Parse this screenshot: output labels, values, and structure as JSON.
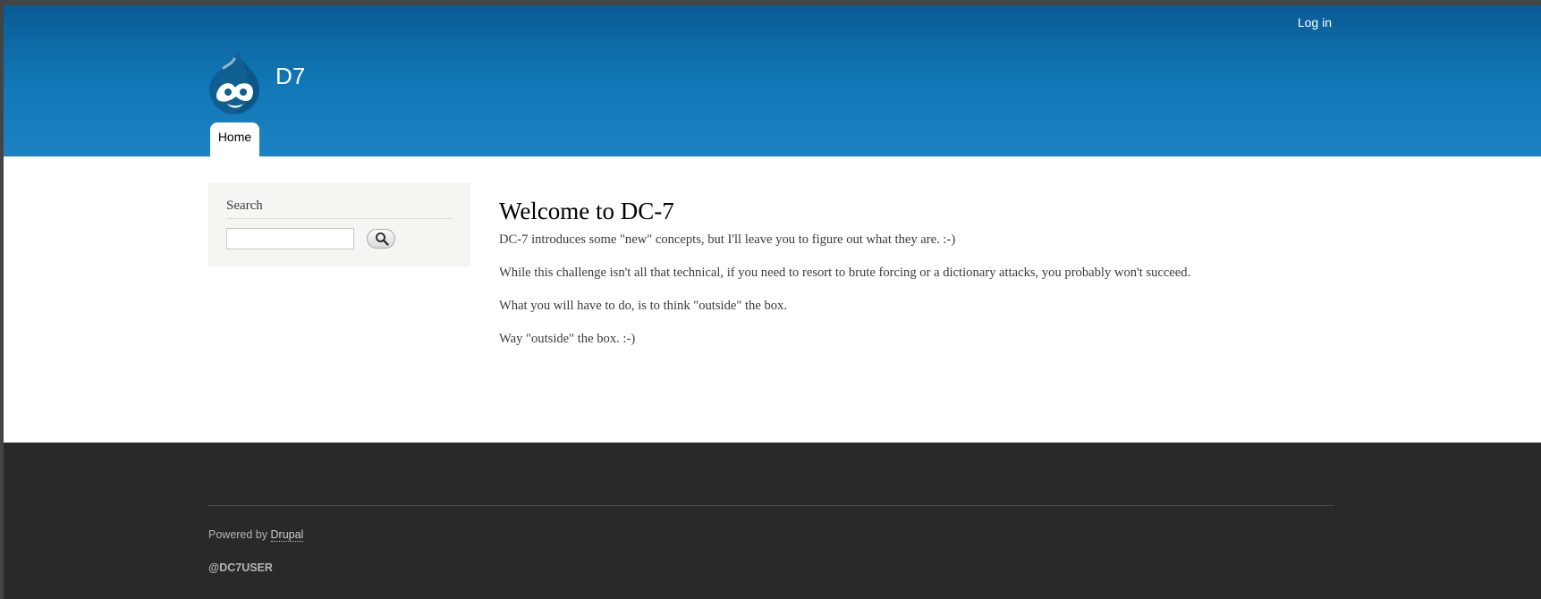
{
  "header": {
    "login_label": "Log in",
    "site_name": "D7",
    "logo_icon": "drupal-drop-icon",
    "nav": [
      {
        "label": "Home",
        "active": true
      }
    ]
  },
  "sidebar": {
    "search": {
      "title": "Search",
      "input_value": "",
      "placeholder": "",
      "button_icon": "search-icon"
    }
  },
  "main": {
    "title": "Welcome to DC-7",
    "paragraphs": [
      "DC-7 introduces some \"new\" concepts, but I'll leave you to figure out what they are.  :-)",
      "While this challenge isn't all that technical, if you need to resort to brute forcing or a dictionary attacks, you probably won't succeed.",
      "What you will have to do, is to think \"outside\" the box.",
      "Way \"outside\" the box.  :-)"
    ]
  },
  "footer": {
    "powered_prefix": "Powered by",
    "powered_link": "Drupal",
    "user_text": "@DC7USER"
  },
  "colors": {
    "header_top": "#0a5b96",
    "header_bottom": "#1d82c2",
    "footer_bg": "#292929",
    "sidebar_block_bg": "#f5f5f2"
  }
}
